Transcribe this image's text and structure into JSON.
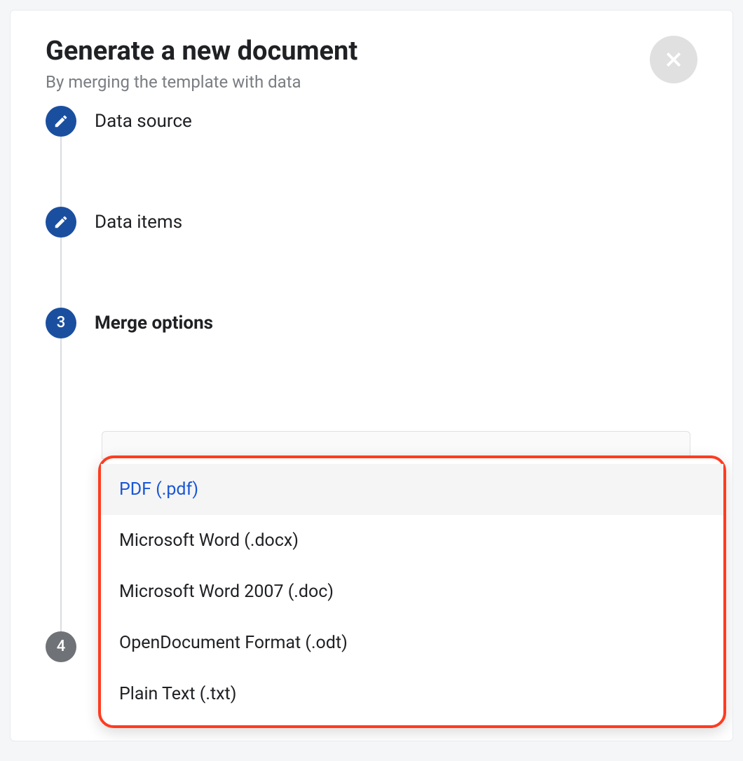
{
  "modal": {
    "title": "Generate a new document",
    "subtitle": "By merging the template with data"
  },
  "steps": [
    {
      "label": "Data source",
      "icon": "pencil"
    },
    {
      "label": "Data items",
      "icon": "pencil"
    },
    {
      "label": "Merge options",
      "number": "3"
    },
    {
      "label": "",
      "number": "4"
    }
  ],
  "dropdown": {
    "options": [
      {
        "label": "PDF (.pdf)",
        "selected": true
      },
      {
        "label": "Microsoft Word (.docx)",
        "selected": false
      },
      {
        "label": "Microsoft Word 2007 (.doc)",
        "selected": false
      },
      {
        "label": "OpenDocument Format (.odt)",
        "selected": false
      },
      {
        "label": "Plain Text (.txt)",
        "selected": false
      }
    ]
  }
}
